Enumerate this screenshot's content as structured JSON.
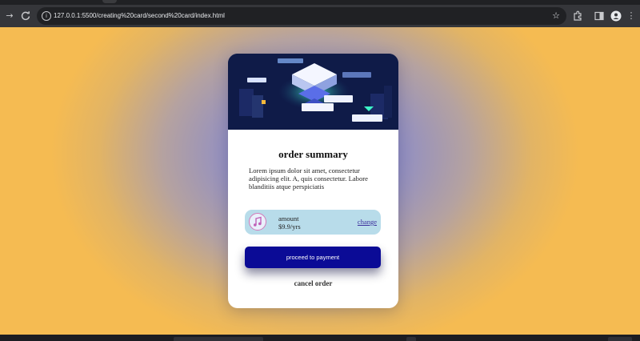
{
  "browser": {
    "url": "127.0.0.1:5500/creating%20card/second%20card/index.html"
  },
  "icons": {
    "back": "arrow-right-icon",
    "reload": "reload-icon",
    "site_info": "info-icon",
    "bookmark": "star-icon",
    "extensions": "puzzle-icon",
    "side_panel": "side-panel-icon",
    "profile": "person-icon",
    "menu": "kebab-menu-icon",
    "plan": "music-note-icon"
  },
  "card": {
    "title": "order summary",
    "description": "Lorem ipsum dolor sit amet, consectetur adipisicing elit. A, quis consectetur. Labore blanditiis atque perspiciatis",
    "plan": {
      "label": "amount",
      "price": "$9.9/yrs",
      "change_label": "change"
    },
    "pay_label": "proceed to payment",
    "cancel_label": "cancel order"
  },
  "colors": {
    "page_bg": "#f3b957",
    "radial_center": "#7478d8",
    "card_bg": "#ffffff",
    "hero_bg": "#101c4a",
    "plan_bg": "#b8dcea",
    "pay_bg": "#0b0b96",
    "link": "#3c2f9c"
  }
}
